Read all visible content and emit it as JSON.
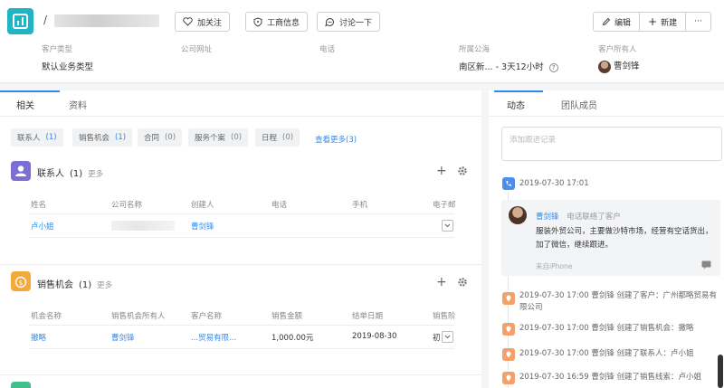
{
  "header": {
    "title_prefix": "/",
    "buttons": {
      "follow": "加关注",
      "business_info": "工商信息",
      "discuss": "讨论一下",
      "edit": "编辑",
      "new": "新建",
      "more": "···"
    },
    "fields": [
      {
        "label": "客户类型",
        "value": "默认业务类型"
      },
      {
        "label": "公司网址",
        "value": ""
      },
      {
        "label": "电话",
        "value": ""
      },
      {
        "label": "所属公海",
        "value": "南区新... - 3天12小时"
      },
      {
        "label": "客户所有人",
        "value": "曹剑锋"
      }
    ]
  },
  "left": {
    "tabs": [
      "相关",
      "资料"
    ],
    "pills": [
      {
        "label": "联系人",
        "count": "(1)"
      },
      {
        "label": "销售机会",
        "count": "(1)"
      },
      {
        "label": "合同",
        "count": "(0)"
      },
      {
        "label": "服务个案",
        "count": "(0)"
      },
      {
        "label": "日程",
        "count": "(0)"
      }
    ],
    "see_more": "查看更多(3)",
    "contacts": {
      "title": "联系人",
      "count": "(1)",
      "more": "更多",
      "columns": [
        "姓名",
        "公司名称",
        "创建人",
        "电话",
        "手机",
        "电子邮"
      ],
      "rows": [
        {
          "name": "卢小姐",
          "company": "",
          "creator": "曹剑锋",
          "phone": "",
          "mobile": ""
        }
      ]
    },
    "opportunities": {
      "title": "销售机会",
      "count": "(1)",
      "more": "更多",
      "columns": [
        "机会名称",
        "销售机会所有人",
        "客户名称",
        "销售金额",
        "结单日期",
        "销售阶"
      ],
      "rows": [
        {
          "name": "撤略",
          "owner": "曹剑锋",
          "customer": "...贸易有限...",
          "amount": "1,000.00元",
          "date": "2019-08-30",
          "stage": "初"
        }
      ]
    }
  },
  "right": {
    "tabs": [
      "动态",
      "团队成员"
    ],
    "comment_placeholder": "添加跟进记录",
    "timeline": [
      {
        "time": "2019-07-30 17:01",
        "type": "phone"
      },
      {
        "time": "2019-07-30 17:00",
        "text": "曹剑锋 创建了客户：广州都略贸易有限公司",
        "type": "pin"
      },
      {
        "time": "2019-07-30 17:00",
        "text": "曹剑锋 创建了销售机会：撤略",
        "type": "pin"
      },
      {
        "time": "2019-07-30 17:00",
        "text": "曹剑锋 创建了联系人：卢小姐",
        "type": "pin"
      },
      {
        "time": "2019-07-30 16:59",
        "text": "曹剑锋 创建了销售线索：卢小姐",
        "type": "pin"
      }
    ],
    "card": {
      "user": "曹剑锋",
      "action": "电话联络了客户",
      "content": "服装外贸公司，主要做沙特市场，经营有空话货出，加了微信，继续跟进。",
      "source": "来自iPhone"
    }
  },
  "colors": {
    "accent": "#2d8cf0",
    "logo": "#1fb4c7",
    "contacts_icon": "#7b6fd6",
    "opportunity_icon": "#f4a93b",
    "timeline_pin": "#f4a06a",
    "timeline_phone": "#4a8ef0"
  }
}
